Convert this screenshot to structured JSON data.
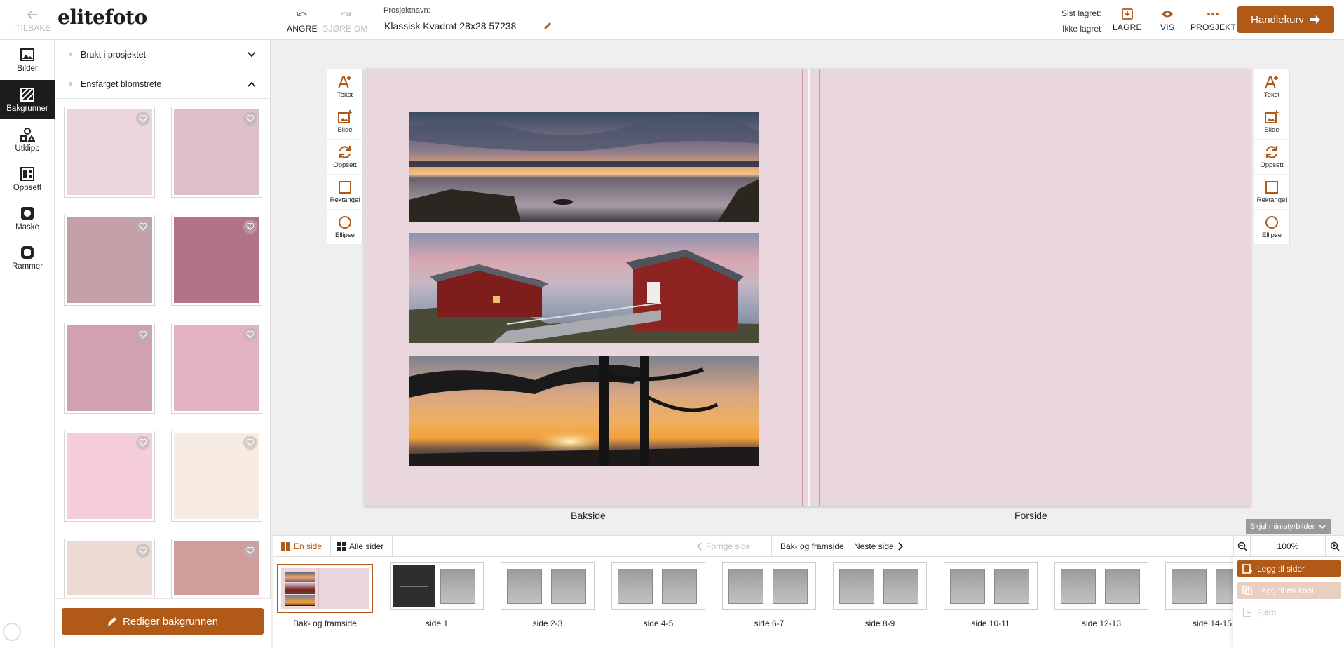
{
  "header": {
    "back_label": "TILBAKE",
    "logo_text": "elitefoto",
    "undo_label": "ANGRE",
    "redo_label": "GJØRE OM",
    "project_name_label": "Prosjektnavn:",
    "project_name_value": "Klassisk Kvadrat 28x28 57238",
    "last_saved_label": "Sist lagret:",
    "last_saved_value": "Ikke lagret",
    "save_label": "LAGRE",
    "view_label": "VIS",
    "project_label": "PROSJEKT",
    "cart_label": "Handlekurv"
  },
  "rail": {
    "items": [
      {
        "label": "Bilder",
        "icon": "image-icon"
      },
      {
        "label": "Bakgrunner",
        "icon": "background-icon",
        "active": true
      },
      {
        "label": "Utklipp",
        "icon": "shapes-icon"
      },
      {
        "label": "Oppsett",
        "icon": "layout-icon"
      },
      {
        "label": "Maske",
        "icon": "mask-icon"
      },
      {
        "label": "Rammer",
        "icon": "frame-icon"
      }
    ]
  },
  "panel": {
    "sections": [
      {
        "label": "Brukt i prosjektet",
        "expanded": false
      },
      {
        "label": "Ensfarget blomstrete",
        "expanded": true
      }
    ],
    "swatches": [
      "#ecd6dc",
      "#dcbfc8",
      "#c3a0a8",
      "#b1728a",
      "#d0a1b0",
      "#e2b3c4",
      "#f6cddd",
      "#f8ebe2",
      "#ecdad3",
      "#cf9e9c"
    ],
    "edit_button_label": "Rediger bakgrunnen"
  },
  "tools": {
    "left": [
      "Tekst",
      "Bilde",
      "Oppsett",
      "Rektangel",
      "Ellipse"
    ],
    "right": [
      "Tekst",
      "Bilde",
      "Oppsett",
      "Rektangel",
      "Ellipse"
    ]
  },
  "spread": {
    "background_color": "#ead7dd",
    "back_label": "Bakside",
    "front_label": "Forside"
  },
  "navbar": {
    "one_page_label": "En side",
    "all_pages_label": "Alle sider",
    "prev_label": "Forrige side",
    "current_label": "Bak- og framside",
    "next_label": "Neste side",
    "zoom": "100%",
    "hide_thumbs_label": "Skjul miniatyrbilder"
  },
  "thumbnails": [
    "Bak- og framside",
    "side 1",
    "side 2-3",
    "side 4-5",
    "side 6-7",
    "side 8-9",
    "side 10-11",
    "side 12-13",
    "side 14-15"
  ],
  "side_actions": {
    "add_pages": "Legg til sider",
    "add_copy": "Legg til en kopi",
    "remove": "Fjern"
  },
  "colors": {
    "accent": "#b15a18",
    "rail_active": "#1c1c1c"
  }
}
